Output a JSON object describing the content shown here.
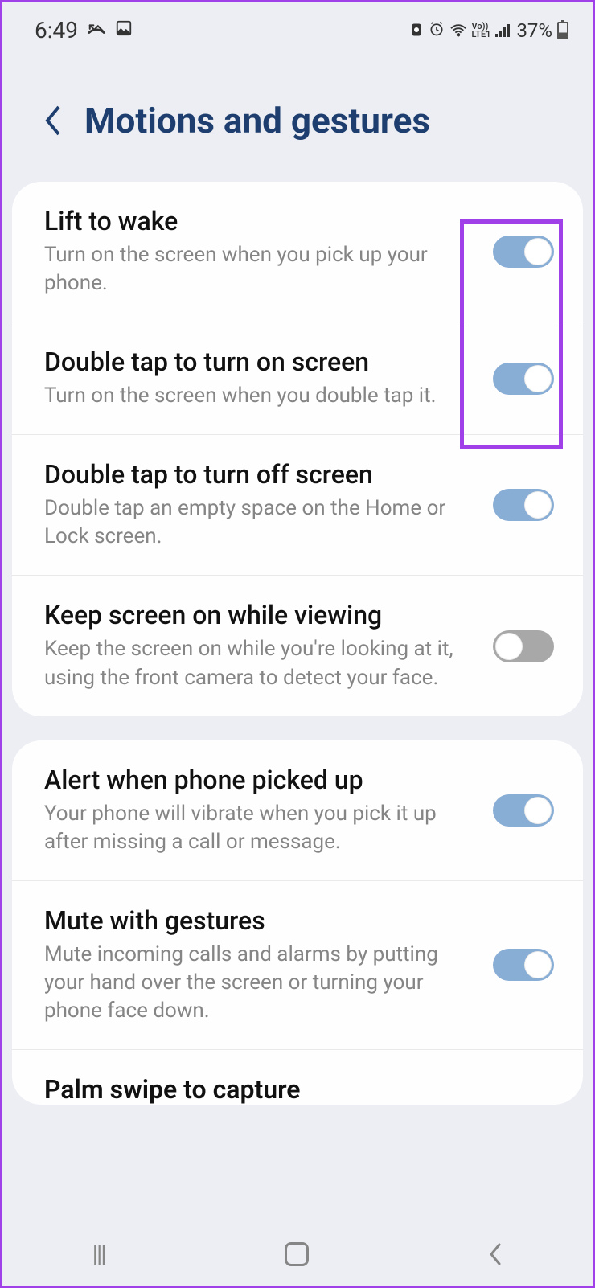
{
  "status": {
    "time": "6:49",
    "battery_pct": "37%",
    "network": "LTE1"
  },
  "page": {
    "title": "Motions and gestures"
  },
  "settings_group1": [
    {
      "title": "Lift to wake",
      "desc": "Turn on the screen when you pick up your phone.",
      "value": true
    },
    {
      "title": "Double tap to turn on screen",
      "desc": "Turn on the screen when you double tap it.",
      "value": true
    },
    {
      "title": "Double tap to turn off screen",
      "desc": "Double tap an empty space on the Home or Lock screen.",
      "value": true
    },
    {
      "title": "Keep screen on while viewing",
      "desc": "Keep the screen on while you're looking at it, using the front camera to detect your face.",
      "value": false
    }
  ],
  "settings_group2": [
    {
      "title": "Alert when phone picked up",
      "desc": "Your phone will vibrate when you pick it up after missing a call or message.",
      "value": true
    },
    {
      "title": "Mute with gestures",
      "desc": "Mute incoming calls and alarms by putting your hand over the screen or turning your phone face down.",
      "value": true
    }
  ],
  "cutoff": {
    "title": "Palm swipe to capture"
  }
}
